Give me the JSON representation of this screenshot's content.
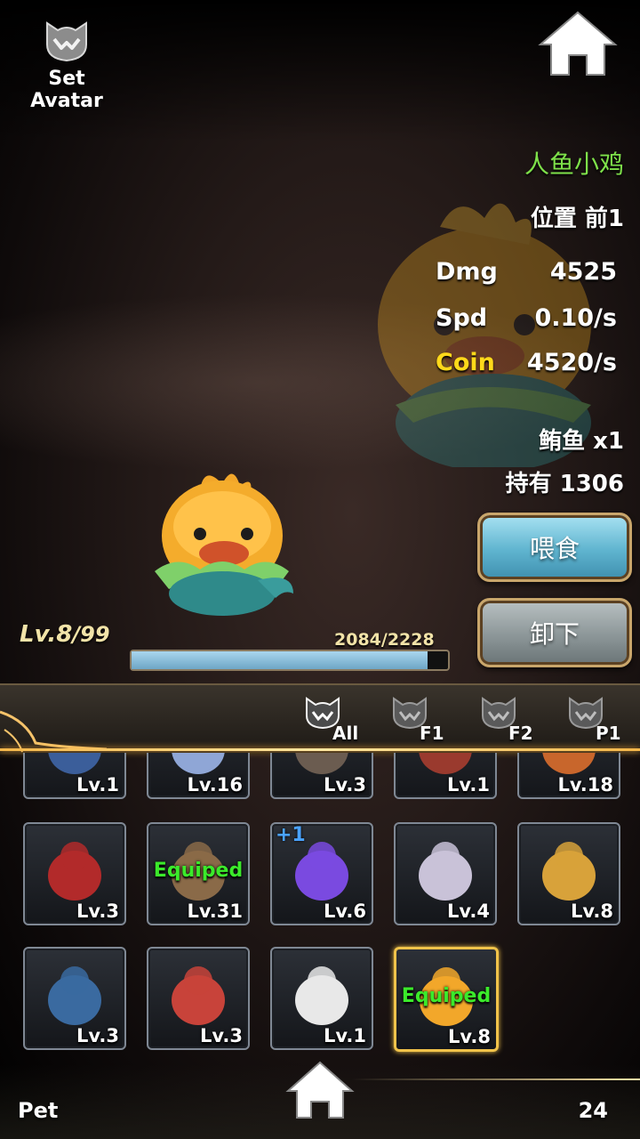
{
  "header": {
    "set_avatar_label": "Set Avatar"
  },
  "pet": {
    "name": "人鱼小鸡",
    "position": "位置 前1",
    "stats": [
      {
        "key": "Dmg",
        "value": "4525",
        "highlight": false
      },
      {
        "key": "Spd",
        "value": "0.10/s",
        "highlight": false
      },
      {
        "key": "Coin",
        "value": "4520/s",
        "highlight": true
      }
    ],
    "food": "鲔鱼 x1",
    "owned": "持有 1306",
    "level": "Lv.8",
    "level_max": "/99",
    "exp_text": "2084/2228",
    "exp_fraction": 0.935
  },
  "actions": {
    "feed_label": "喂食",
    "unequip_label": "卸下"
  },
  "filters": [
    {
      "label": "All",
      "active": true
    },
    {
      "label": "F1",
      "active": false
    },
    {
      "label": "F2",
      "active": false
    },
    {
      "label": "P1",
      "active": false
    }
  ],
  "pet_slots": [
    {
      "level": "Lv.1",
      "equipped": "",
      "plus": "",
      "color": "#3b5e9a"
    },
    {
      "level": "Lv.16",
      "equipped": "",
      "plus": "",
      "color": "#8fa6d6"
    },
    {
      "level": "Lv.3",
      "equipped": "",
      "plus": "",
      "color": "#6b5c50"
    },
    {
      "level": "Lv.1",
      "equipped": "",
      "plus": "",
      "color": "#9a3a2e"
    },
    {
      "level": "Lv.18",
      "equipped": "",
      "plus": "",
      "color": "#c8662c"
    },
    {
      "level": "Lv.3",
      "equipped": "",
      "plus": "",
      "color": "#b22a2a"
    },
    {
      "level": "Lv.31",
      "equipped": "Equiped",
      "plus": "",
      "color": "#8a6a48"
    },
    {
      "level": "Lv.6",
      "equipped": "",
      "plus": "+1",
      "color": "#7a4ae0"
    },
    {
      "level": "Lv.4",
      "equipped": "",
      "plus": "",
      "color": "#c9c2d8"
    },
    {
      "level": "Lv.8",
      "equipped": "",
      "plus": "",
      "color": "#d8a23a"
    },
    {
      "level": "Lv.3",
      "equipped": "",
      "plus": "",
      "color": "#3a6aa0"
    },
    {
      "level": "Lv.3",
      "equipped": "",
      "plus": "",
      "color": "#c8433a"
    },
    {
      "level": "Lv.1",
      "equipped": "",
      "plus": "",
      "color": "#e8e8e8"
    },
    {
      "level": "Lv.8",
      "equipped": "Equiped",
      "plus": "",
      "color": "#f2a72a"
    }
  ],
  "footer": {
    "section_label": "Pet",
    "count": "24"
  },
  "colors": {
    "name_green": "#7ee04a",
    "coin_yellow": "#ffd91a",
    "equipped_green": "#3bea2b",
    "gold_accent": "#f1c34a"
  }
}
